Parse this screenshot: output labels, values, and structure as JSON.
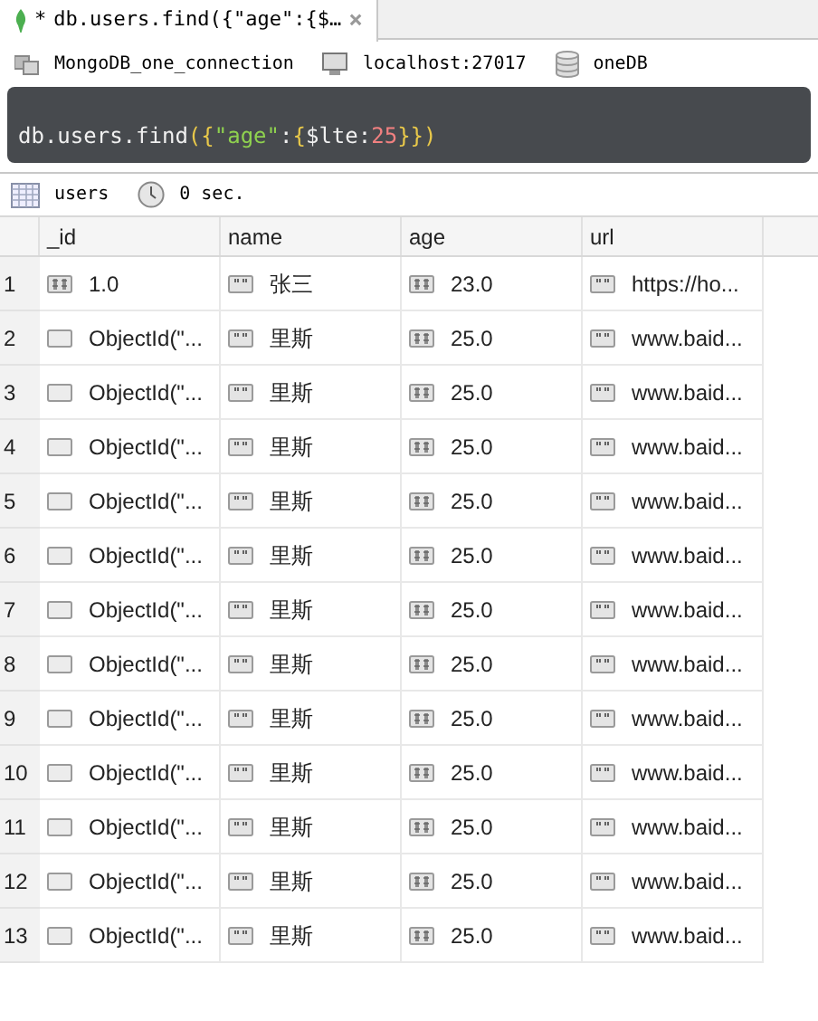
{
  "tab": {
    "title": "db.users.find({\"age\":{$…",
    "modified_mark": "*",
    "close": "×"
  },
  "connection": {
    "name": "MongoDB_one_connection",
    "server": "localhost:27017",
    "database": "oneDB"
  },
  "query": [
    {
      "text": "db.users.find",
      "kind": "plain"
    },
    {
      "text": "({",
      "kind": "bracket"
    },
    {
      "text": "\"age\"",
      "kind": "string"
    },
    {
      "text": ":",
      "kind": "plain"
    },
    {
      "text": "{",
      "kind": "bracket"
    },
    {
      "text": "$lte",
      "kind": "plain"
    },
    {
      "text": ":",
      "kind": "plain"
    },
    {
      "text": "25",
      "kind": "number"
    },
    {
      "text": "}})",
      "kind": "bracket"
    }
  ],
  "result_info": {
    "collection": "users",
    "time": "0 sec."
  },
  "table": {
    "columns": [
      "_id",
      "name",
      "age",
      "url"
    ],
    "rows": [
      {
        "num": "1",
        "cells": [
          {
            "kind": "number",
            "text": "1.0"
          },
          {
            "kind": "string",
            "text": "张三"
          },
          {
            "kind": "number",
            "text": "23.0"
          },
          {
            "kind": "string",
            "text": "https://ho..."
          }
        ]
      },
      {
        "num": "2",
        "cells": [
          {
            "kind": "objectid",
            "text": "ObjectId(\"..."
          },
          {
            "kind": "string",
            "text": "里斯"
          },
          {
            "kind": "number",
            "text": "25.0"
          },
          {
            "kind": "string",
            "text": "www.baid..."
          }
        ]
      },
      {
        "num": "3",
        "cells": [
          {
            "kind": "objectid",
            "text": "ObjectId(\"..."
          },
          {
            "kind": "string",
            "text": "里斯"
          },
          {
            "kind": "number",
            "text": "25.0"
          },
          {
            "kind": "string",
            "text": "www.baid..."
          }
        ]
      },
      {
        "num": "4",
        "cells": [
          {
            "kind": "objectid",
            "text": "ObjectId(\"..."
          },
          {
            "kind": "string",
            "text": "里斯"
          },
          {
            "kind": "number",
            "text": "25.0"
          },
          {
            "kind": "string",
            "text": "www.baid..."
          }
        ]
      },
      {
        "num": "5",
        "cells": [
          {
            "kind": "objectid",
            "text": "ObjectId(\"..."
          },
          {
            "kind": "string",
            "text": "里斯"
          },
          {
            "kind": "number",
            "text": "25.0"
          },
          {
            "kind": "string",
            "text": "www.baid..."
          }
        ]
      },
      {
        "num": "6",
        "cells": [
          {
            "kind": "objectid",
            "text": "ObjectId(\"..."
          },
          {
            "kind": "string",
            "text": "里斯"
          },
          {
            "kind": "number",
            "text": "25.0"
          },
          {
            "kind": "string",
            "text": "www.baid..."
          }
        ]
      },
      {
        "num": "7",
        "cells": [
          {
            "kind": "objectid",
            "text": "ObjectId(\"..."
          },
          {
            "kind": "string",
            "text": "里斯"
          },
          {
            "kind": "number",
            "text": "25.0"
          },
          {
            "kind": "string",
            "text": "www.baid..."
          }
        ]
      },
      {
        "num": "8",
        "cells": [
          {
            "kind": "objectid",
            "text": "ObjectId(\"..."
          },
          {
            "kind": "string",
            "text": "里斯"
          },
          {
            "kind": "number",
            "text": "25.0"
          },
          {
            "kind": "string",
            "text": "www.baid..."
          }
        ]
      },
      {
        "num": "9",
        "cells": [
          {
            "kind": "objectid",
            "text": "ObjectId(\"..."
          },
          {
            "kind": "string",
            "text": "里斯"
          },
          {
            "kind": "number",
            "text": "25.0"
          },
          {
            "kind": "string",
            "text": "www.baid..."
          }
        ]
      },
      {
        "num": "10",
        "cells": [
          {
            "kind": "objectid",
            "text": "ObjectId(\"..."
          },
          {
            "kind": "string",
            "text": "里斯"
          },
          {
            "kind": "number",
            "text": "25.0"
          },
          {
            "kind": "string",
            "text": "www.baid..."
          }
        ]
      },
      {
        "num": "11",
        "cells": [
          {
            "kind": "objectid",
            "text": "ObjectId(\"..."
          },
          {
            "kind": "string",
            "text": "里斯"
          },
          {
            "kind": "number",
            "text": "25.0"
          },
          {
            "kind": "string",
            "text": "www.baid..."
          }
        ]
      },
      {
        "num": "12",
        "cells": [
          {
            "kind": "objectid",
            "text": "ObjectId(\"..."
          },
          {
            "kind": "string",
            "text": "里斯"
          },
          {
            "kind": "number",
            "text": "25.0"
          },
          {
            "kind": "string",
            "text": "www.baid..."
          }
        ]
      },
      {
        "num": "13",
        "cells": [
          {
            "kind": "objectid",
            "text": "ObjectId(\"..."
          },
          {
            "kind": "string",
            "text": "里斯"
          },
          {
            "kind": "number",
            "text": "25.0"
          },
          {
            "kind": "string",
            "text": "www.baid..."
          }
        ]
      }
    ]
  }
}
